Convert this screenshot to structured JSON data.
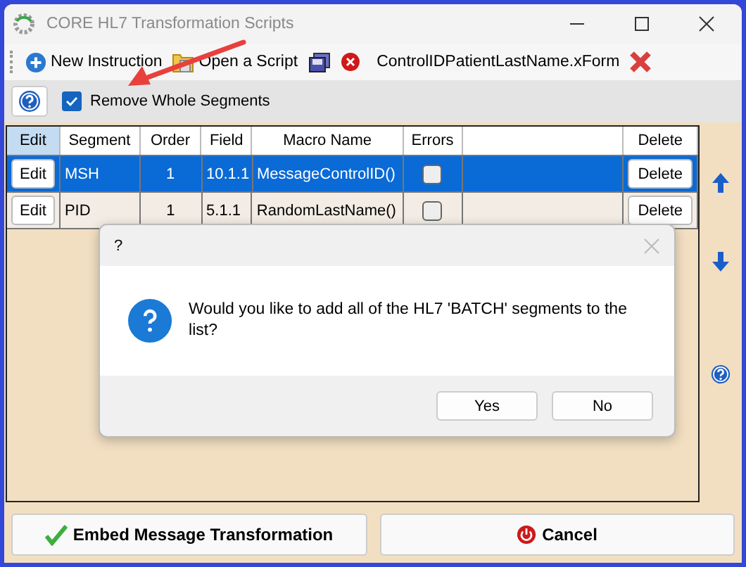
{
  "window": {
    "title": "CORE HL7 Transformation Scripts"
  },
  "toolbar": [
    {
      "kind": "new",
      "label": "New Instruction"
    },
    {
      "kind": "open",
      "label": "Open a Script"
    },
    {
      "kind": "save"
    },
    {
      "kind": "file",
      "label": "ControlIDPatientLastName.xForm"
    },
    {
      "kind": "remove"
    }
  ],
  "remove_whole_segments": {
    "label": "Remove Whole Segments",
    "checked": true
  },
  "table": {
    "columns": [
      "Edit",
      "Segment",
      "Order",
      "Field",
      "Macro Name",
      "Errors",
      "",
      "Delete"
    ],
    "rows": [
      {
        "edit": "Edit",
        "segment": "MSH",
        "order": "1",
        "field": "10.1.1",
        "macro": "MessageControlID()",
        "errors": false,
        "delete": "Delete",
        "selected": true
      },
      {
        "edit": "Edit",
        "segment": "PID",
        "order": "1",
        "field": "5.1.1",
        "macro": "RandomLastName()",
        "errors": false,
        "delete": "Delete",
        "selected": false
      }
    ]
  },
  "dialog": {
    "title": "?",
    "message": "Would you like to add all of the HL7 'BATCH' segments to the list?",
    "buttons": [
      "Yes",
      "No"
    ]
  },
  "footer": [
    {
      "kind": "ok",
      "label": "Embed Message Transformation"
    },
    {
      "kind": "cancel",
      "label": "Cancel"
    }
  ]
}
